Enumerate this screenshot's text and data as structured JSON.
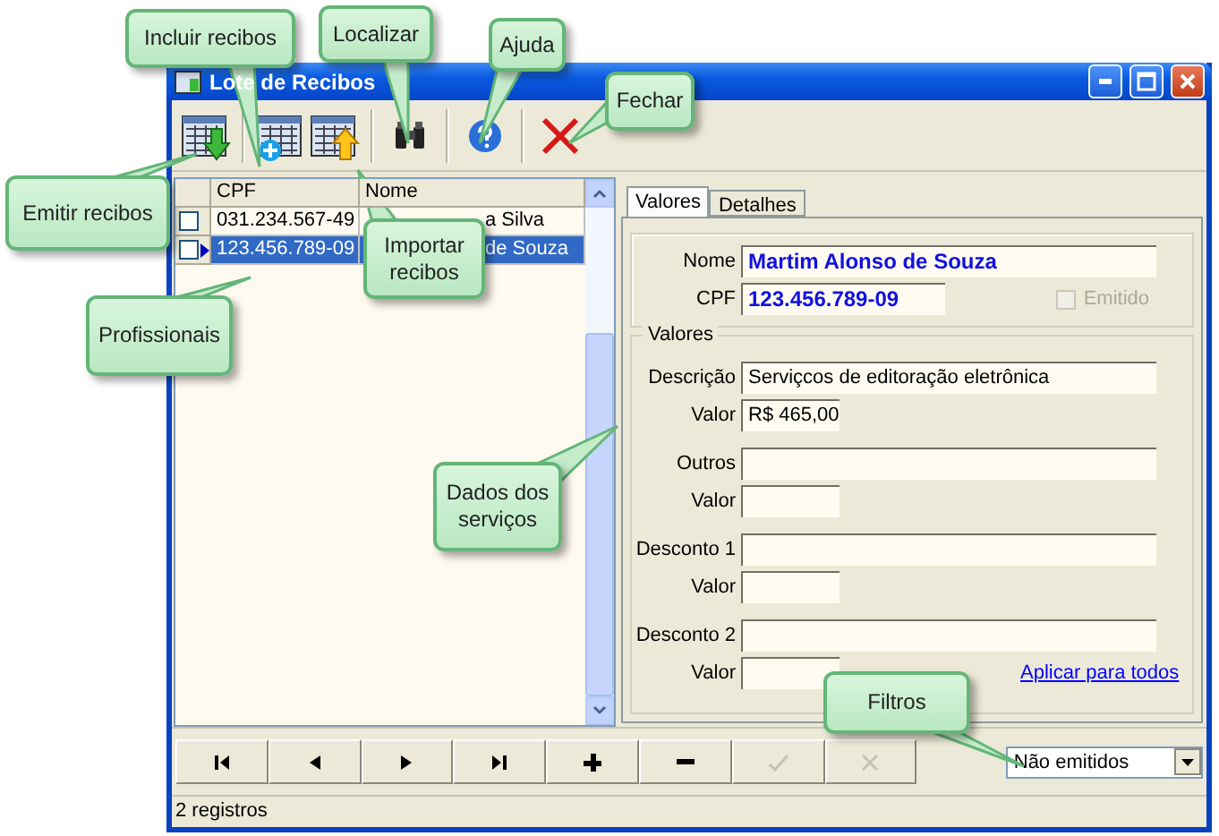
{
  "window": {
    "title": "Lote de Recibos"
  },
  "grid": {
    "columns": [
      "CPF",
      "Nome"
    ],
    "rows": [
      {
        "checked": false,
        "selected": false,
        "cpf": "031.234.567-49",
        "name": "a Silva"
      },
      {
        "checked": false,
        "selected": true,
        "cpf": "123.456.789-09",
        "name": "de Souza"
      }
    ]
  },
  "tabs": [
    {
      "label": "Valores",
      "selected": true
    },
    {
      "label": "Detalhes",
      "selected": false
    }
  ],
  "person": {
    "name_label": "Nome",
    "name": "Martim Alonso de Souza",
    "cpf_label": "CPF",
    "cpf": "123.456.789-09"
  },
  "emitido": {
    "label": "Emitido",
    "checked": false,
    "disabled": true
  },
  "valores": {
    "title": "Valores",
    "rows": [
      {
        "label": "Descrição",
        "value": "Serviçcos de editoração eletrônica",
        "value_label": "Valor",
        "amount": "R$ 465,00"
      },
      {
        "label": "Outros",
        "value_label": "Valor"
      },
      {
        "label": "Desconto 1",
        "value_label": "Valor"
      },
      {
        "label": "Desconto 2",
        "value_label": "Valor"
      }
    ]
  },
  "apply_link": "Aplicar para todos",
  "nav_buttons": [
    {
      "kind": "first",
      "disabled": false
    },
    {
      "kind": "prev",
      "disabled": false
    },
    {
      "kind": "next",
      "disabled": false
    },
    {
      "kind": "last",
      "disabled": false
    },
    {
      "kind": "add",
      "disabled": false
    },
    {
      "kind": "remove",
      "disabled": false
    },
    {
      "kind": "confirm",
      "disabled": true
    },
    {
      "kind": "cancel",
      "disabled": true
    }
  ],
  "filter": {
    "value": "Não emitidos"
  },
  "status_bar": "2 registros",
  "callouts": [
    "Incluir recibos",
    "Localizar",
    "Ajuda",
    "Fechar",
    "Emitir recibos",
    "Importar recibos",
    "Profissionais",
    "Dados dos serviços",
    "Filtros"
  ]
}
